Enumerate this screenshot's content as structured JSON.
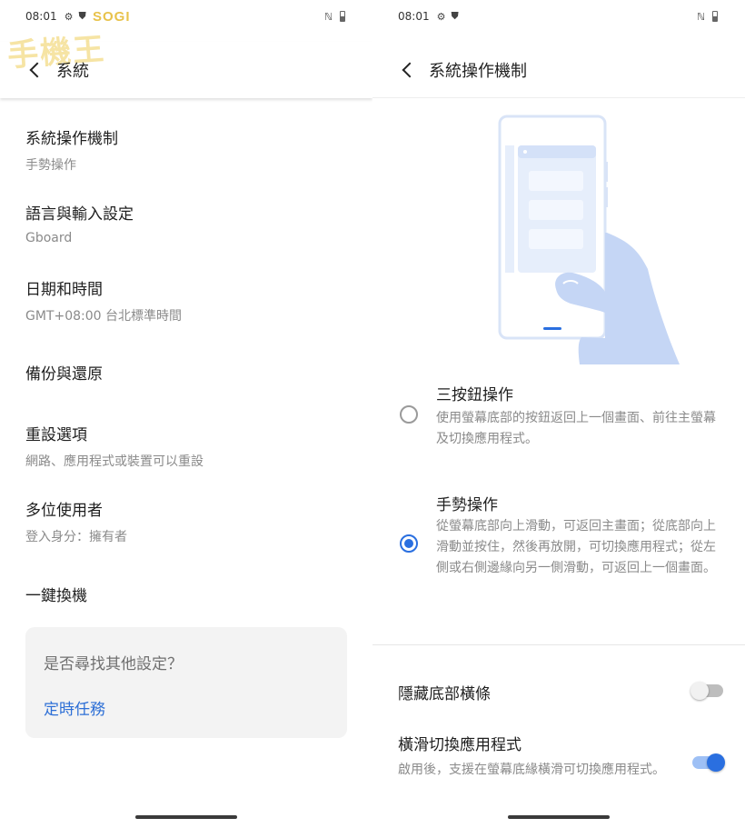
{
  "status_bar": {
    "time": "08:01"
  },
  "watermark": {
    "brand": "SOGI",
    "chars": "手機王"
  },
  "left": {
    "title": "系統",
    "items": [
      {
        "title": "系統操作機制",
        "subtitle": "手勢操作"
      },
      {
        "title": "語言與輸入設定",
        "subtitle": "Gboard"
      },
      {
        "title": "日期和時間",
        "subtitle": "GMT+08:00 台北標準時間"
      },
      {
        "title": "備份與還原"
      },
      {
        "title": "重設選項",
        "subtitle": "網路、應用程式或裝置可以重設"
      },
      {
        "title": "多位使用者",
        "subtitle": "登入身分：擁有者"
      },
      {
        "title": "一鍵換機"
      }
    ],
    "suggestion": {
      "question": "是否尋找其他設定？",
      "link": "定時任務"
    }
  },
  "right": {
    "title": "系統操作機制",
    "options": [
      {
        "title": "三按鈕操作",
        "description": "使用螢幕底部的按鈕返回上一個畫面、前往主螢幕及切換應用程式。",
        "selected": false
      },
      {
        "title": "手勢操作",
        "description": "從螢幕底部向上滑動，可返回主畫面；從底部向上滑動並按住，然後再放開，可切換應用程式；從左側或右側邊緣向另一側滑動，可返回上一個畫面。",
        "selected": true
      }
    ],
    "settings": [
      {
        "title": "隱藏底部橫條",
        "enabled": false
      },
      {
        "title": "橫滑切換應用程式",
        "subtitle": "啟用後，支援在螢幕底緣橫滑可切換應用程式。",
        "enabled": true
      }
    ]
  },
  "colors": {
    "accent": "#2a6fe0",
    "link": "#2d6fd6",
    "illustration_hand": "#c5d6f5"
  },
  "icons": {
    "status": [
      "settings-gear-icon",
      "shield-icon",
      "nfc-icon",
      "battery-icon"
    ],
    "nav": "back-arrow-icon"
  }
}
